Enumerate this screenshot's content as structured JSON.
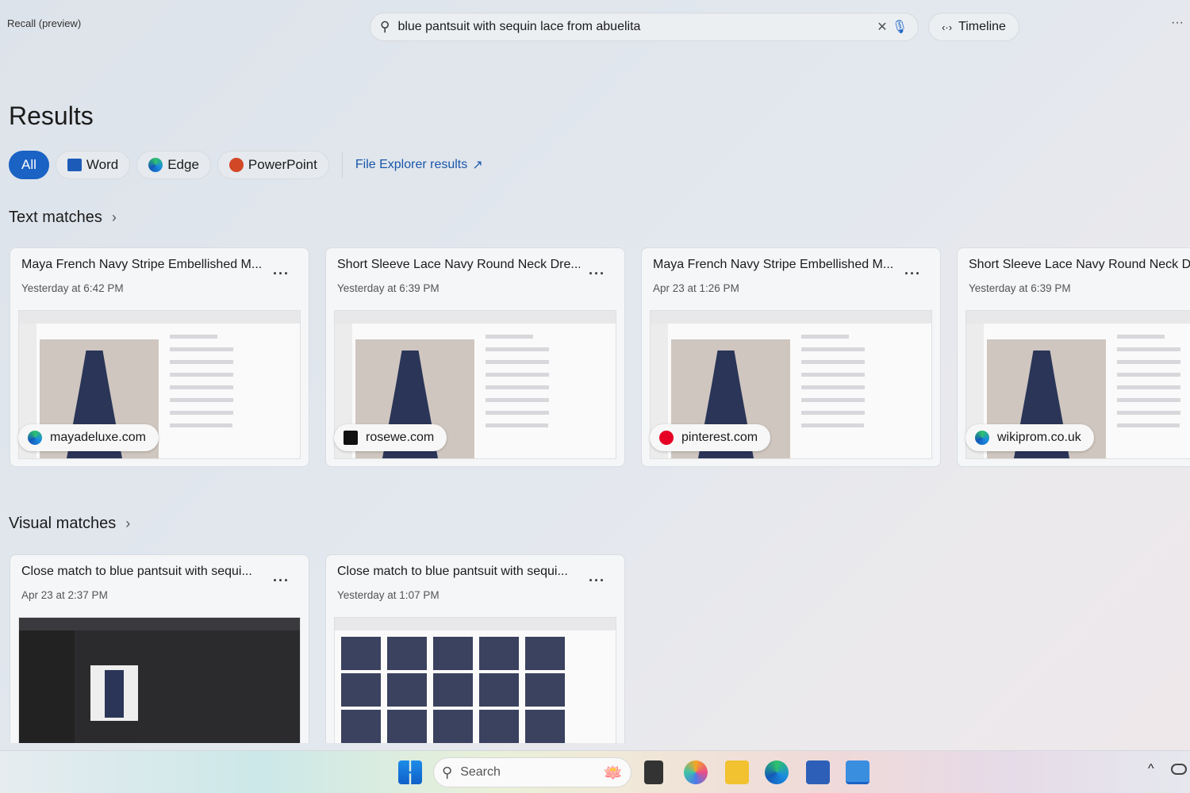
{
  "app": {
    "title": "Recall (preview)"
  },
  "search": {
    "value": "blue pantsuit with sequin lace from abuelita",
    "clear_icon": "close-icon",
    "mic_icon": "microphone-icon"
  },
  "timeline": {
    "label": "Timeline",
    "icon": "code-brackets-icon"
  },
  "more_icon": "more-horizontal-icon",
  "results_heading": "Results",
  "filters": [
    {
      "label": "All",
      "active": true
    },
    {
      "label": "Word",
      "icon": "word-icon"
    },
    {
      "label": "Edge",
      "icon": "edge-icon"
    },
    {
      "label": "PowerPoint",
      "icon": "powerpoint-icon"
    }
  ],
  "file_explorer_link": "File Explorer results",
  "text_matches": {
    "heading": "Text matches",
    "cards": [
      {
        "title": "Maya French Navy Stripe Embellished M...",
        "date": "Yesterday at 6:42 PM",
        "site": "mayadeluxe.com",
        "site_icon": "edge-icon"
      },
      {
        "title": "Short Sleeve Lace Navy Round Neck Dre...",
        "date": "Yesterday at 6:39 PM",
        "site": "rosewe.com",
        "site_icon": "rosewe-icon"
      },
      {
        "title": "Maya French Navy Stripe Embellished M...",
        "date": "Apr 23 at 1:26 PM",
        "site": "pinterest.com",
        "site_icon": "pinterest-icon"
      },
      {
        "title": "Short Sleeve Lace Navy Round Neck Dr",
        "date": "Yesterday at 6:39 PM",
        "site": "wikiprom.co.uk",
        "site_icon": "edge-icon"
      }
    ]
  },
  "visual_matches": {
    "heading": "Visual matches",
    "cards": [
      {
        "title": "Close match to blue pantsuit with sequi...",
        "date": "Apr 23 at 2:37 PM"
      },
      {
        "title": "Close match to blue pantsuit with sequi...",
        "date": "Yesterday at 1:07 PM"
      }
    ]
  },
  "taskbar": {
    "search_placeholder": "Search"
  },
  "colors": {
    "accent": "#1a62c4",
    "link": "#1a56a8"
  }
}
